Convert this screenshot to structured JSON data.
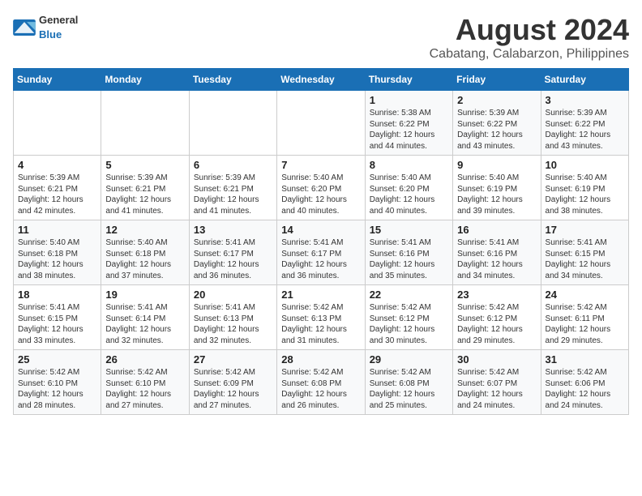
{
  "header": {
    "logo_general": "General",
    "logo_blue": "Blue",
    "main_title": "August 2024",
    "subtitle": "Cabatang, Calabarzon, Philippines"
  },
  "weekdays": [
    "Sunday",
    "Monday",
    "Tuesday",
    "Wednesday",
    "Thursday",
    "Friday",
    "Saturday"
  ],
  "weeks": [
    [
      {
        "day": "",
        "info": ""
      },
      {
        "day": "",
        "info": ""
      },
      {
        "day": "",
        "info": ""
      },
      {
        "day": "",
        "info": ""
      },
      {
        "day": "1",
        "info": "Sunrise: 5:38 AM\nSunset: 6:22 PM\nDaylight: 12 hours\nand 44 minutes."
      },
      {
        "day": "2",
        "info": "Sunrise: 5:39 AM\nSunset: 6:22 PM\nDaylight: 12 hours\nand 43 minutes."
      },
      {
        "day": "3",
        "info": "Sunrise: 5:39 AM\nSunset: 6:22 PM\nDaylight: 12 hours\nand 43 minutes."
      }
    ],
    [
      {
        "day": "4",
        "info": "Sunrise: 5:39 AM\nSunset: 6:21 PM\nDaylight: 12 hours\nand 42 minutes."
      },
      {
        "day": "5",
        "info": "Sunrise: 5:39 AM\nSunset: 6:21 PM\nDaylight: 12 hours\nand 41 minutes."
      },
      {
        "day": "6",
        "info": "Sunrise: 5:39 AM\nSunset: 6:21 PM\nDaylight: 12 hours\nand 41 minutes."
      },
      {
        "day": "7",
        "info": "Sunrise: 5:40 AM\nSunset: 6:20 PM\nDaylight: 12 hours\nand 40 minutes."
      },
      {
        "day": "8",
        "info": "Sunrise: 5:40 AM\nSunset: 6:20 PM\nDaylight: 12 hours\nand 40 minutes."
      },
      {
        "day": "9",
        "info": "Sunrise: 5:40 AM\nSunset: 6:19 PM\nDaylight: 12 hours\nand 39 minutes."
      },
      {
        "day": "10",
        "info": "Sunrise: 5:40 AM\nSunset: 6:19 PM\nDaylight: 12 hours\nand 38 minutes."
      }
    ],
    [
      {
        "day": "11",
        "info": "Sunrise: 5:40 AM\nSunset: 6:18 PM\nDaylight: 12 hours\nand 38 minutes."
      },
      {
        "day": "12",
        "info": "Sunrise: 5:40 AM\nSunset: 6:18 PM\nDaylight: 12 hours\nand 37 minutes."
      },
      {
        "day": "13",
        "info": "Sunrise: 5:41 AM\nSunset: 6:17 PM\nDaylight: 12 hours\nand 36 minutes."
      },
      {
        "day": "14",
        "info": "Sunrise: 5:41 AM\nSunset: 6:17 PM\nDaylight: 12 hours\nand 36 minutes."
      },
      {
        "day": "15",
        "info": "Sunrise: 5:41 AM\nSunset: 6:16 PM\nDaylight: 12 hours\nand 35 minutes."
      },
      {
        "day": "16",
        "info": "Sunrise: 5:41 AM\nSunset: 6:16 PM\nDaylight: 12 hours\nand 34 minutes."
      },
      {
        "day": "17",
        "info": "Sunrise: 5:41 AM\nSunset: 6:15 PM\nDaylight: 12 hours\nand 34 minutes."
      }
    ],
    [
      {
        "day": "18",
        "info": "Sunrise: 5:41 AM\nSunset: 6:15 PM\nDaylight: 12 hours\nand 33 minutes."
      },
      {
        "day": "19",
        "info": "Sunrise: 5:41 AM\nSunset: 6:14 PM\nDaylight: 12 hours\nand 32 minutes."
      },
      {
        "day": "20",
        "info": "Sunrise: 5:41 AM\nSunset: 6:13 PM\nDaylight: 12 hours\nand 32 minutes."
      },
      {
        "day": "21",
        "info": "Sunrise: 5:42 AM\nSunset: 6:13 PM\nDaylight: 12 hours\nand 31 minutes."
      },
      {
        "day": "22",
        "info": "Sunrise: 5:42 AM\nSunset: 6:12 PM\nDaylight: 12 hours\nand 30 minutes."
      },
      {
        "day": "23",
        "info": "Sunrise: 5:42 AM\nSunset: 6:12 PM\nDaylight: 12 hours\nand 29 minutes."
      },
      {
        "day": "24",
        "info": "Sunrise: 5:42 AM\nSunset: 6:11 PM\nDaylight: 12 hours\nand 29 minutes."
      }
    ],
    [
      {
        "day": "25",
        "info": "Sunrise: 5:42 AM\nSunset: 6:10 PM\nDaylight: 12 hours\nand 28 minutes."
      },
      {
        "day": "26",
        "info": "Sunrise: 5:42 AM\nSunset: 6:10 PM\nDaylight: 12 hours\nand 27 minutes."
      },
      {
        "day": "27",
        "info": "Sunrise: 5:42 AM\nSunset: 6:09 PM\nDaylight: 12 hours\nand 27 minutes."
      },
      {
        "day": "28",
        "info": "Sunrise: 5:42 AM\nSunset: 6:08 PM\nDaylight: 12 hours\nand 26 minutes."
      },
      {
        "day": "29",
        "info": "Sunrise: 5:42 AM\nSunset: 6:08 PM\nDaylight: 12 hours\nand 25 minutes."
      },
      {
        "day": "30",
        "info": "Sunrise: 5:42 AM\nSunset: 6:07 PM\nDaylight: 12 hours\nand 24 minutes."
      },
      {
        "day": "31",
        "info": "Sunrise: 5:42 AM\nSunset: 6:06 PM\nDaylight: 12 hours\nand 24 minutes."
      }
    ]
  ]
}
